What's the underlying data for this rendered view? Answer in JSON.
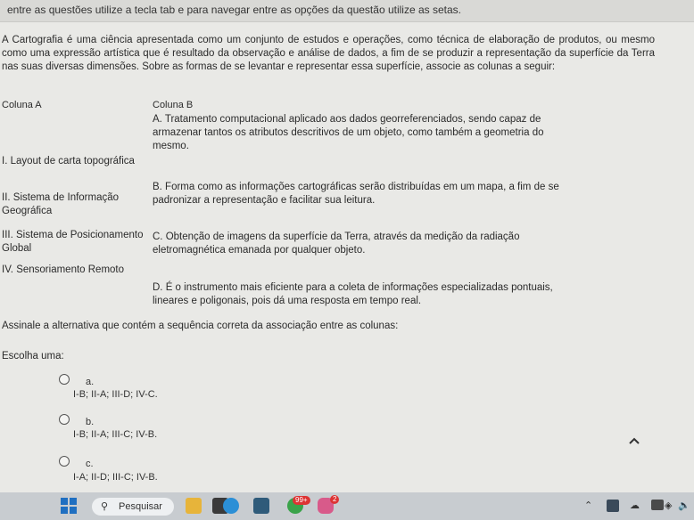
{
  "instruction": "entre as questões utilize a tecla tab e para navegar entre as opções da questão utilize as setas.",
  "question": {
    "paragraph": "A Cartografia é uma ciência apresentada como um conjunto de estudos e operações, como técnica de elaboração de produtos, ou mesmo como uma expressão artística que é resultado da observação e análise de dados, a fim de se produzir a representação da superfície da Terra nas suas diversas dimensões. Sobre as formas de se levantar e representar essa superfície, associe as colunas a seguir:",
    "col_a_header": "Coluna A",
    "col_b_header": "Coluna B",
    "col_a": [
      "I. Layout de carta topográfica",
      "II. Sistema de Informação Geográfica",
      "III. Sistema de Posicionamento Global",
      "IV. Sensoriamento Remoto"
    ],
    "col_b": [
      "A. Tratamento computacional aplicado aos dados georreferenciados, sendo capaz de armazenar tantos os atributos descritivos de um objeto, como também a geometria do mesmo.",
      "B. Forma como as informações cartográficas serão distribuídas em um mapa, a fim de se padronizar a representação e facilitar sua leitura.",
      "C. Obtenção de imagens da superfície da Terra, através da medição da radiação eletromagnética emanada por qualquer objeto.",
      "D. É o instrumento mais eficiente para a coleta de informações especializadas pontuais, lineares e poligonais, pois dá uma resposta em tempo real."
    ],
    "prompt": "Assinale a alternativa que contém a sequência correta da associação entre as colunas:",
    "choose_label": "Escolha uma:",
    "options": [
      {
        "letter": "a.",
        "text": "I-B; II-A; III-D; IV-C."
      },
      {
        "letter": "b.",
        "text": "I-B; II-A; III-C; IV-B."
      },
      {
        "letter": "c.",
        "text": "I-A; II-D; III-C; IV-B."
      }
    ]
  },
  "scroll_top_icon": "chevron-up-icon",
  "taskbar": {
    "search_label": "Pesquisar",
    "mail_badge": "99+",
    "app_badge": "2"
  },
  "colors": {
    "page_bg": "#e9e9e6",
    "taskbar_bg": "#c8ccd0",
    "windows_blue": "#1f6fc1"
  }
}
